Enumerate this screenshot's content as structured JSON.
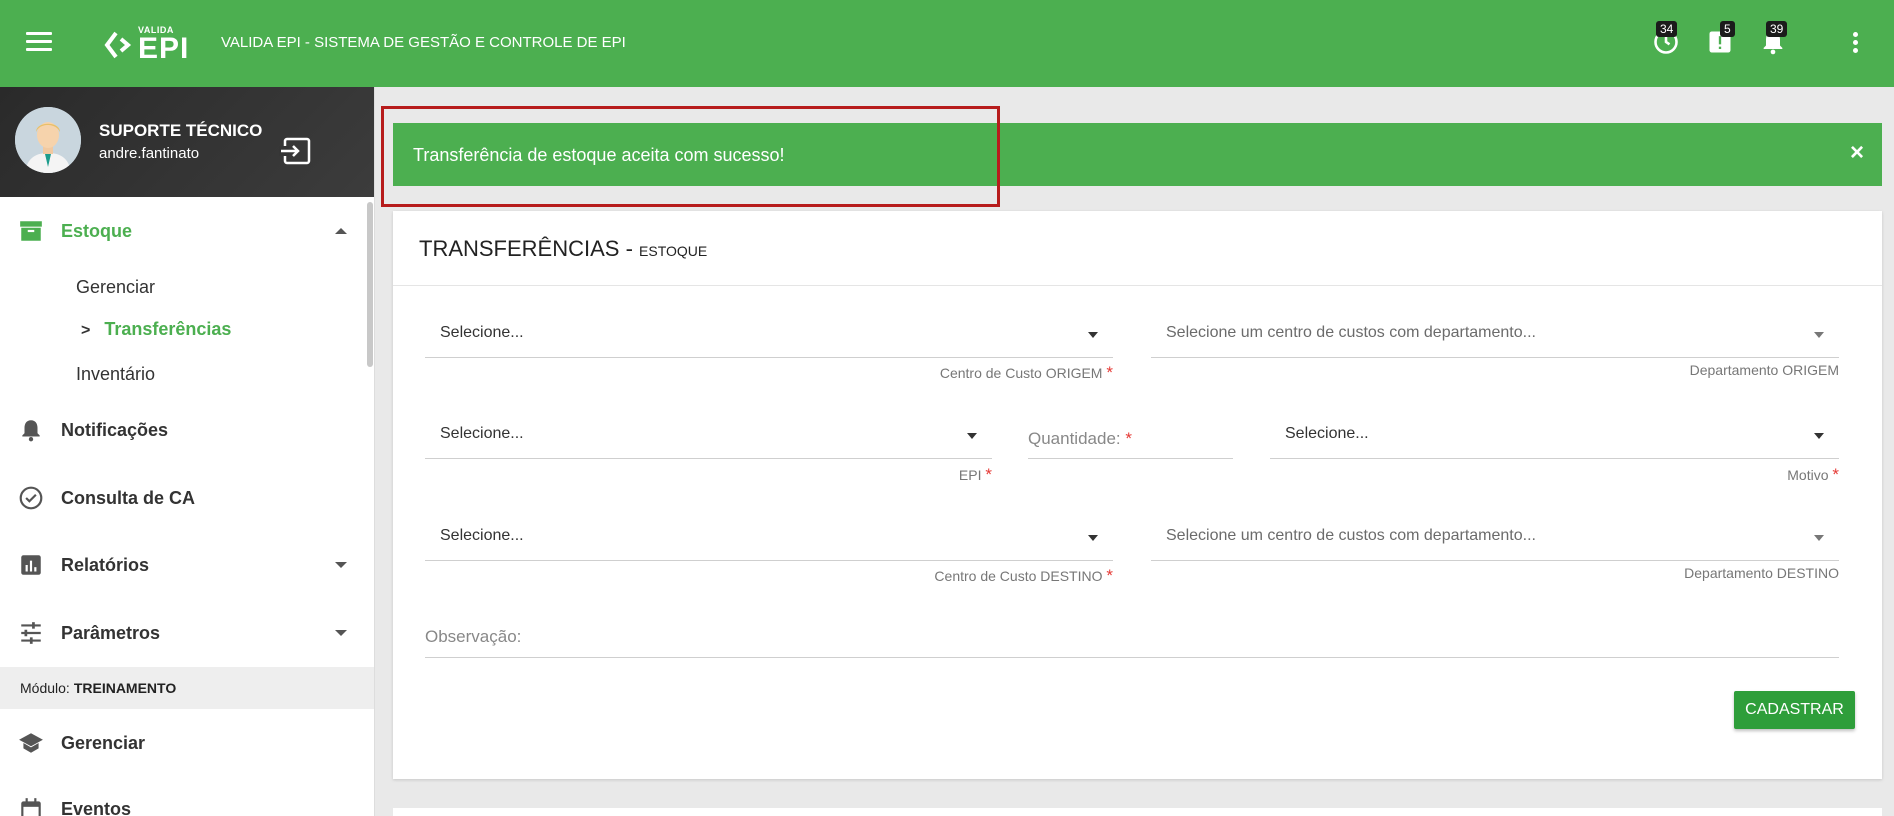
{
  "header": {
    "logo_small": "VALIDA",
    "logo_big": "EPI",
    "title": "VALIDA EPI - SISTEMA DE GESTÃO E CONTROLE DE EPI",
    "badges": {
      "history": "34",
      "alerts": "5",
      "notifications": "39"
    }
  },
  "user": {
    "name": "SUPORTE TÉCNICO",
    "login": "andre.fantinato"
  },
  "sidebar": {
    "estoque": "Estoque",
    "estoque_items": {
      "gerenciar": "Gerenciar",
      "transferencias": "Transferências",
      "inventario": "Inventário"
    },
    "notificacoes": "Notificações",
    "consulta_ca": "Consulta de CA",
    "relatorios": "Relatórios",
    "parametros": "Parâmetros",
    "module_label": "Módulo:",
    "module_name": "TREINAMENTO",
    "gerenciar": "Gerenciar",
    "eventos": "Eventos",
    "accent_color": "#4caf50"
  },
  "alert": {
    "text": "Transferência de estoque aceita com sucesso!",
    "close": "×"
  },
  "card": {
    "title": "TRANSFERÊNCIAS - ",
    "subtitle": "ESTOQUE",
    "fields": {
      "cc_origem": {
        "value": "Selecione...",
        "label": "Centro de Custo ORIGEM"
      },
      "dep_origem": {
        "value": "Selecione um centro de custos com departamento...",
        "label": "Departamento ORIGEM"
      },
      "epi": {
        "value": "Selecione...",
        "label": "EPI"
      },
      "quantidade": {
        "label": "Quantidade:"
      },
      "motivo": {
        "value": "Selecione...",
        "label": "Motivo"
      },
      "cc_destino": {
        "value": "Selecione...",
        "label": "Centro de Custo DESTINO"
      },
      "dep_destino": {
        "value": "Selecione um centro de custos com departamento...",
        "label": "Departamento DESTINO"
      },
      "observacao": {
        "label": "Observação:"
      }
    },
    "required_mark": "*",
    "submit": "CADASTRAR"
  }
}
